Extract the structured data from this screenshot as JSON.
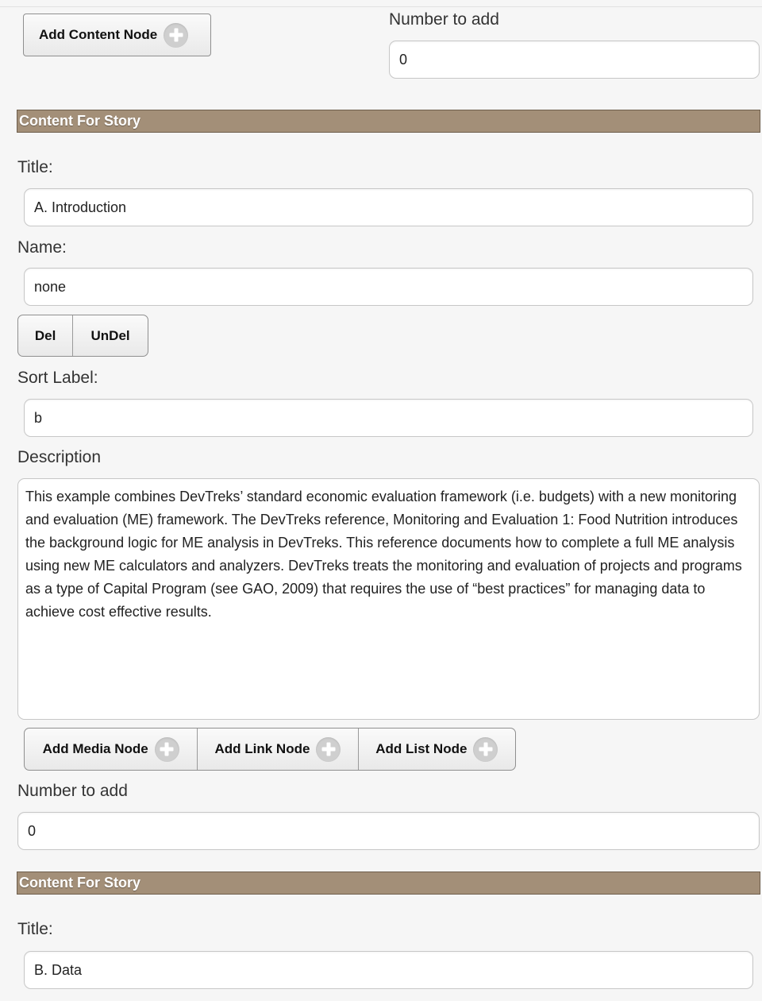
{
  "top": {
    "add_content_node_label": "Add Content Node",
    "number_to_add_label": "Number to add",
    "number_to_add_value": "0"
  },
  "section1": {
    "header": "Content For Story",
    "title_label": "Title:",
    "title_value": "A. Introduction",
    "name_label": "Name:",
    "name_value": "none",
    "del_label": "Del",
    "undel_label": "UnDel",
    "sort_label": "Sort Label:",
    "sort_value": "b",
    "description_label": "Description",
    "description_value": "This example combines DevTreks’ standard economic evaluation framework (i.e. budgets) with a new monitoring and evaluation (ME) framework. The DevTreks reference, Monitoring and Evaluation 1: Food Nutrition introduces the background logic for ME analysis in DevTreks. This reference documents how to complete a full ME analysis using new ME calculators and analyzers. DevTreks treats the monitoring and evaluation of projects and programs as a type of Capital Program (see GAO, 2009) that requires the use of “best practices” for managing data to achieve cost effective results.",
    "add_media_node_label": "Add Media Node",
    "add_link_node_label": "Add Link Node",
    "add_list_node_label": "Add List Node",
    "number_to_add_label": "Number to add",
    "number_to_add_value": "0"
  },
  "section2": {
    "header": "Content For Story",
    "title_label": "Title:",
    "title_value": "B. Data"
  },
  "colors": {
    "section_header_bg": "#a38f78",
    "page_bg": "#f6f6f6"
  }
}
